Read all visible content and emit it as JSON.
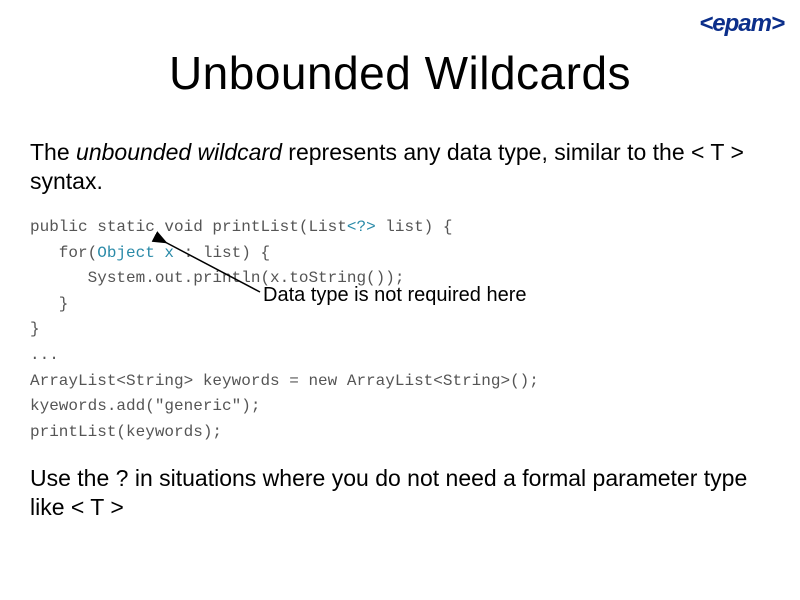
{
  "logo": "<epam>",
  "title": "Unbounded Wildcards",
  "intro": {
    "pre": "The ",
    "em": "unbounded wildcard",
    "post": " represents any data type, similar to the < T > syntax."
  },
  "code": {
    "l1a": "public static void printList(List",
    "l1b": "<?>",
    "l1c": " list) {",
    "l2a": "   for(",
    "l2b": "Object x",
    "l2c": " : list) {",
    "l3": "      System.out.println(x.toString());",
    "l4": "   }",
    "l5": "}",
    "l6": "...",
    "l7": "ArrayList<String> keywords = new ArrayList<String>();",
    "l8": "kyewords.add(\"generic\");",
    "l9": "printList(keywords);"
  },
  "callout": "Data type is not required here",
  "outro": "Use the ? in situations where you do not need a formal parameter type like < T >"
}
